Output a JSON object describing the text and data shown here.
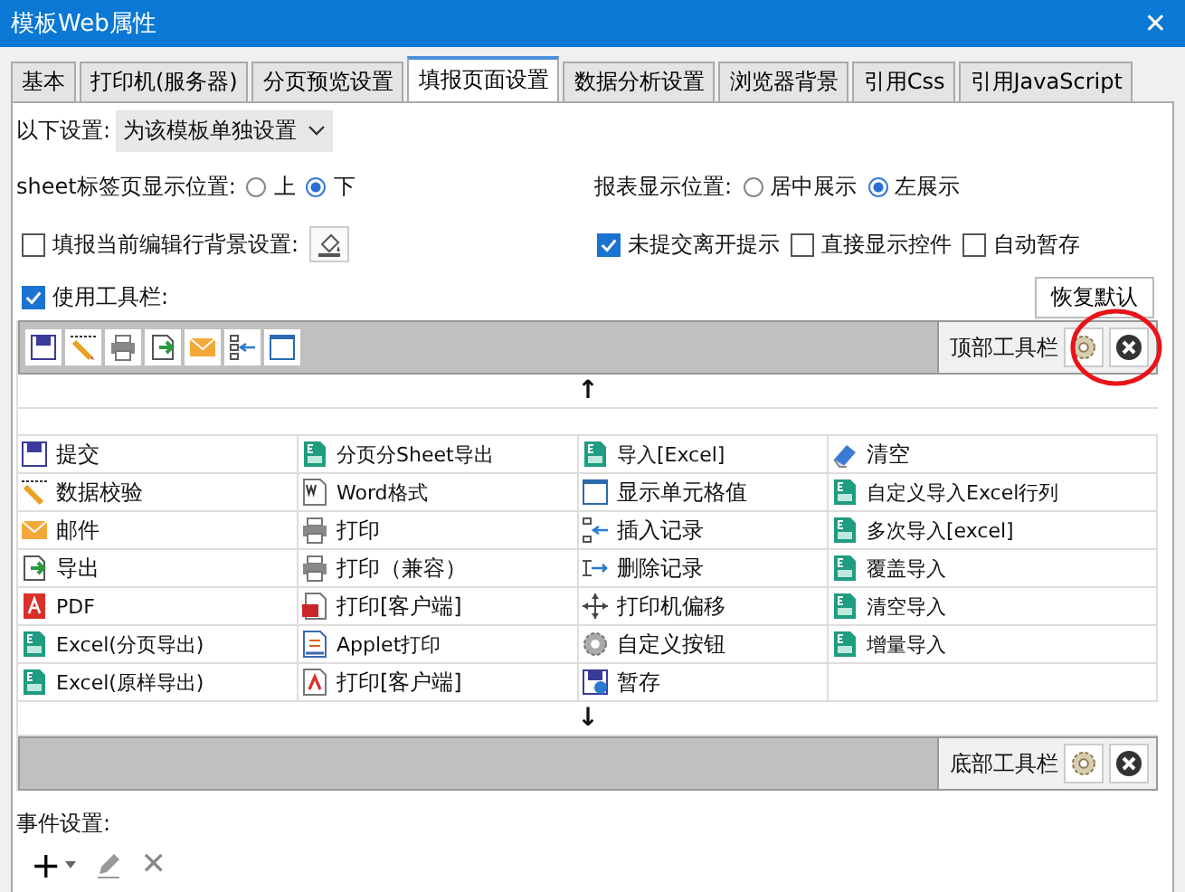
{
  "window": {
    "title": "模板Web属性",
    "close": "✕"
  },
  "tabs": [
    {
      "label": "基本",
      "selected": false
    },
    {
      "label": "打印机(服务器)",
      "selected": false
    },
    {
      "label": "分页预览设置",
      "selected": false
    },
    {
      "label": "填报页面设置",
      "selected": true
    },
    {
      "label": "数据分析设置",
      "selected": false
    },
    {
      "label": "浏览器背景",
      "selected": false
    },
    {
      "label": "引用Css",
      "selected": false
    },
    {
      "label": "引用JavaScript",
      "selected": false
    }
  ],
  "scope": {
    "label": "以下设置:",
    "value": "为该模板单独设置"
  },
  "sheet_position": {
    "label": "sheet标签页显示位置:",
    "options": [
      {
        "label": "上",
        "selected": false
      },
      {
        "label": "下",
        "selected": true
      }
    ]
  },
  "report_position": {
    "label": "报表显示位置:",
    "options": [
      {
        "label": "居中展示",
        "selected": false
      },
      {
        "label": "左展示",
        "selected": true
      }
    ]
  },
  "edit_row_background": {
    "label": "填报当前编辑行背景设置:",
    "checked": false
  },
  "options": [
    {
      "label": "未提交离开提示",
      "checked": true
    },
    {
      "label": "直接显示控件",
      "checked": false
    },
    {
      "label": "自动暂存",
      "checked": false
    }
  ],
  "use_toolbar": {
    "label": "使用工具栏:",
    "checked": true
  },
  "restore_button": "恢复默认",
  "top_toolbar": {
    "label": "顶部工具栏",
    "icons": [
      {
        "kind": "save"
      },
      {
        "kind": "check"
      },
      {
        "kind": "print"
      },
      {
        "kind": "export"
      },
      {
        "kind": "mail"
      },
      {
        "kind": "insert"
      },
      {
        "kind": "cell"
      }
    ]
  },
  "up_arrow": "↑",
  "buttons": [
    {
      "label": "提交",
      "kind": "save"
    },
    {
      "label": "分页分Sheet导出",
      "kind": "excel"
    },
    {
      "label": "导入[Excel]",
      "kind": "excel"
    },
    {
      "label": "清空",
      "kind": "eraser"
    },
    {
      "label": "数据校验",
      "kind": "check"
    },
    {
      "label": "Word格式",
      "kind": "word"
    },
    {
      "label": "显示单元格值",
      "kind": "cell"
    },
    {
      "label": "自定义导入Excel行列",
      "kind": "excel"
    },
    {
      "label": "邮件",
      "kind": "mail"
    },
    {
      "label": "打印",
      "kind": "print"
    },
    {
      "label": "插入记录",
      "kind": "insert"
    },
    {
      "label": "多次导入[excel]",
      "kind": "excel"
    },
    {
      "label": "导出",
      "kind": "export"
    },
    {
      "label": "打印（兼容）",
      "kind": "print"
    },
    {
      "label": "删除记录",
      "kind": "delete"
    },
    {
      "label": "覆盖导入",
      "kind": "excel"
    },
    {
      "label": "PDF",
      "kind": "pdf"
    },
    {
      "label": "打印[客户端]",
      "kind": "flash"
    },
    {
      "label": "打印机偏移",
      "kind": "move"
    },
    {
      "label": "清空导入",
      "kind": "excel"
    },
    {
      "label": "Excel(分页导出)",
      "kind": "excel"
    },
    {
      "label": "Applet打印",
      "kind": "applet"
    },
    {
      "label": "自定义按钮",
      "kind": "gear"
    },
    {
      "label": "增量导入",
      "kind": "excel"
    },
    {
      "label": "Excel(原样导出)",
      "kind": "excel"
    },
    {
      "label": "打印[客户端]",
      "kind": "pdfdoc"
    },
    {
      "label": "暂存",
      "kind": "savetime"
    }
  ],
  "down_arrow": "↓",
  "bottom_toolbar": {
    "label": "底部工具栏"
  },
  "events": {
    "label": "事件设置:",
    "add": "+",
    "delete": "✕"
  }
}
